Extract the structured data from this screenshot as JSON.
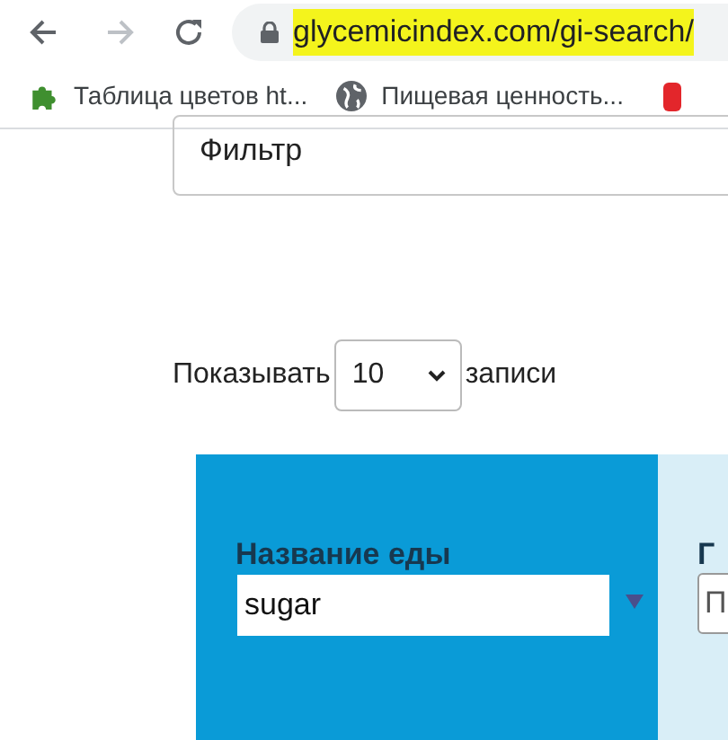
{
  "browser": {
    "url": "glycemicindex.com/gi-search/",
    "url_highlighted": true,
    "bookmarks": [
      {
        "kind": "extension",
        "label": "Таблица цветов ht..."
      },
      {
        "kind": "globe",
        "label": "Пищевая ценность..."
      },
      {
        "kind": "red"
      }
    ]
  },
  "filter": {
    "value": "Фильтр"
  },
  "length_menu": {
    "before": "Показывать",
    "value": "10",
    "after": "записи"
  },
  "table": {
    "columns": [
      {
        "label": "Название еды",
        "filter_value": "sugar",
        "sorted": true
      },
      {
        "label": "Г",
        "filter_value": "П"
      }
    ]
  }
}
